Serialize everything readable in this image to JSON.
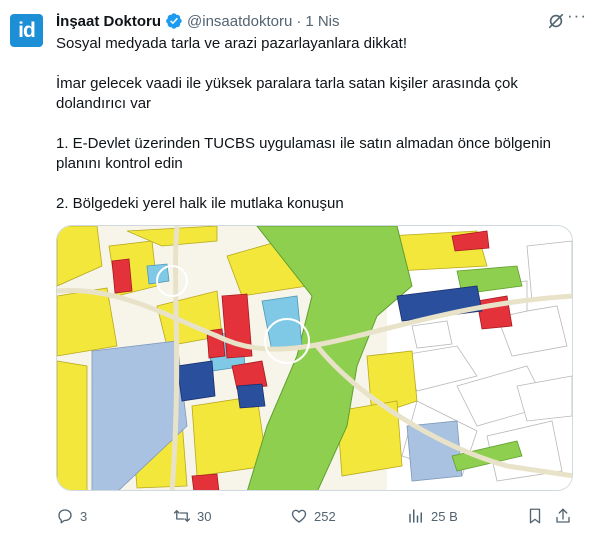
{
  "author": {
    "display_name": "İnşaat Doktoru",
    "handle": "@insaatdoktoru",
    "separator": "·",
    "time": "1 Nis",
    "avatar_text": "id",
    "avatar_color": "#1d8fd6",
    "verified_color": "#1d9bf0"
  },
  "tweet": {
    "lines": [
      "Sosyal medyada tarla ve arazi pazarlayanlara dikkat!",
      "İmar gelecek vaadi ile yüksek paralara tarla satan kişiler arasında çok dolandırıcı var",
      "1. E-Devlet üzerinden TUCBS uygulaması ile satın almadan önce bölgenin planını kontrol edin",
      "2. Bölgedeki yerel halk ile mutlaka konuşun"
    ]
  },
  "media": {
    "type": "zoning-plan-map",
    "zone_colors": {
      "residential": "#f2e73a",
      "commercial": "#e4323a",
      "public": "#a9c2e2",
      "green": "#8fcf4f",
      "institutional": "#2a4f9c",
      "social": "#7fc8e6",
      "road": "#f7f5ea",
      "unplanned": "#ffffff"
    }
  },
  "actions": {
    "replies": "3",
    "reposts": "30",
    "likes": "252",
    "views": "25 B"
  }
}
